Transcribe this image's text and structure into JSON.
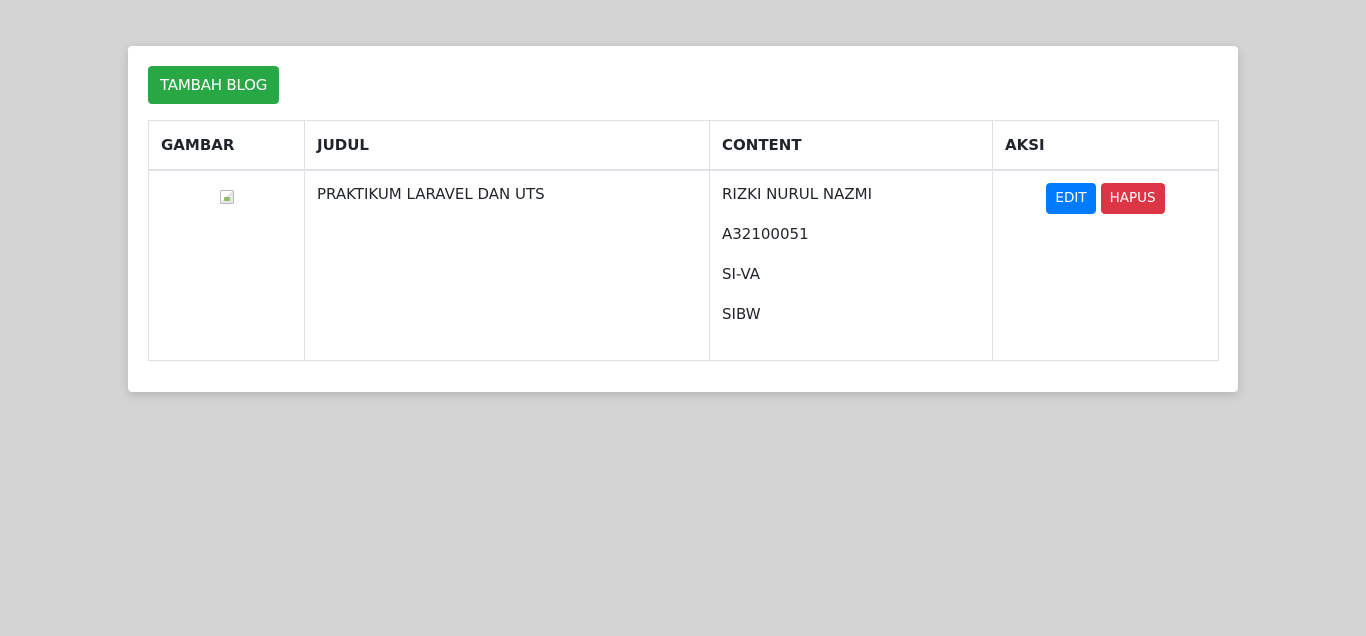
{
  "toolbar": {
    "add_label": "TAMBAH BLOG"
  },
  "table": {
    "headers": [
      "GAMBAR",
      "JUDUL",
      "CONTENT",
      "AKSI"
    ],
    "rows": [
      {
        "image_icon": "broken-image-icon",
        "judul": "PRAKTIKUM LARAVEL DAN UTS",
        "content": [
          "RIZKI NURUL NAZMI",
          "A32100051",
          "SI-VA",
          "SIBW"
        ],
        "edit_label": "EDIT",
        "delete_label": "HAPUS"
      }
    ]
  },
  "colors": {
    "background": "#d4d4d4",
    "add_button": "#28a745",
    "edit_button": "#007bff",
    "delete_button": "#dc3545"
  }
}
